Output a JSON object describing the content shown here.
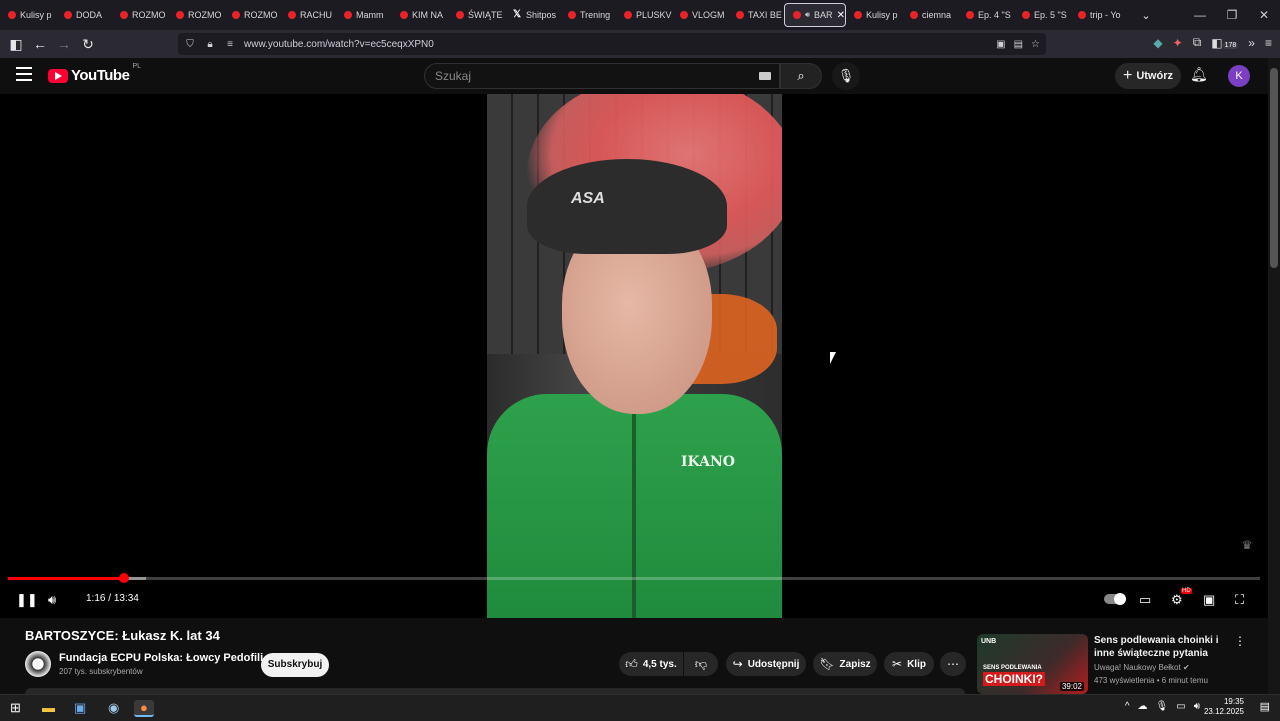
{
  "browser": {
    "tabs": [
      {
        "label": "Kulisy p",
        "icon": "youtube-icon"
      },
      {
        "label": "DODA",
        "icon": "youtube-icon"
      },
      {
        "label": "ROZMO",
        "icon": "youtube-icon"
      },
      {
        "label": "ROZMO",
        "icon": "youtube-icon"
      },
      {
        "label": "ROZMO",
        "icon": "youtube-icon"
      },
      {
        "label": "RACHU",
        "icon": "youtube-icon"
      },
      {
        "label": "Mamm",
        "icon": "youtube-icon"
      },
      {
        "label": "KIM NA",
        "icon": "youtube-icon"
      },
      {
        "label": "ŚWIĄTE",
        "icon": "youtube-icon"
      },
      {
        "label": "Shitpos",
        "icon": "x-icon"
      },
      {
        "label": "Trening",
        "icon": "youtube-icon"
      },
      {
        "label": "PLUSKV",
        "icon": "youtube-icon"
      },
      {
        "label": "VLOGM",
        "icon": "youtube-icon"
      },
      {
        "label": "TAXI BE",
        "icon": "youtube-icon"
      },
      {
        "label": "BAR",
        "icon": "youtube-icon",
        "active": true
      },
      {
        "label": "Kulisy p",
        "icon": "youtube-icon"
      },
      {
        "label": "ciemna",
        "icon": "youtube-icon"
      },
      {
        "label": "Ep. 4 \"S",
        "icon": "youtube-icon"
      },
      {
        "label": "Ep. 5 \"S",
        "icon": "youtube-icon"
      },
      {
        "label": "trip - Yo",
        "icon": "youtube-icon"
      }
    ],
    "url": "www.youtube.com/watch?v=ec5ceqxXPN0",
    "extensions_badge": "178"
  },
  "youtube": {
    "logo_text": "YouTube",
    "region": "PL",
    "search_placeholder": "Szukaj",
    "create_label": "Utwórz",
    "avatar_letter": "K"
  },
  "player": {
    "current_time": "1:16",
    "duration": "13:34",
    "time_separator": " / ",
    "progress_fraction": 0.093,
    "buffered_fraction": 0.11,
    "shirt_text": "IKANO",
    "cap_text": "ASA"
  },
  "video": {
    "title": "BARTOSZYCE: Łukasz K. lat 34",
    "channel_name": "Fundacja ECPU Polska: Łowcy Pedofili",
    "subscribers": "207 tys. subskrybentów",
    "subscribe_label": "Subskrybuj",
    "likes": "4,5 tys.",
    "share_label": "Udostępnij",
    "save_label": "Zapisz",
    "clip_label": "Klip"
  },
  "recommendation": {
    "title": "Sens podlewania choinki i inne świąteczne pytania",
    "channel": "Uwaga! Naukowy Bełkot",
    "meta": "473 wyświetlenia • 6 minut temu",
    "duration": "39:02",
    "thumb_text_small": "SENS PODLEWANIA",
    "thumb_text_big": "CHOINKI?",
    "thumb_logo": "UNB"
  },
  "taskbar": {
    "time": "19:35",
    "date": "23.12.2025"
  }
}
